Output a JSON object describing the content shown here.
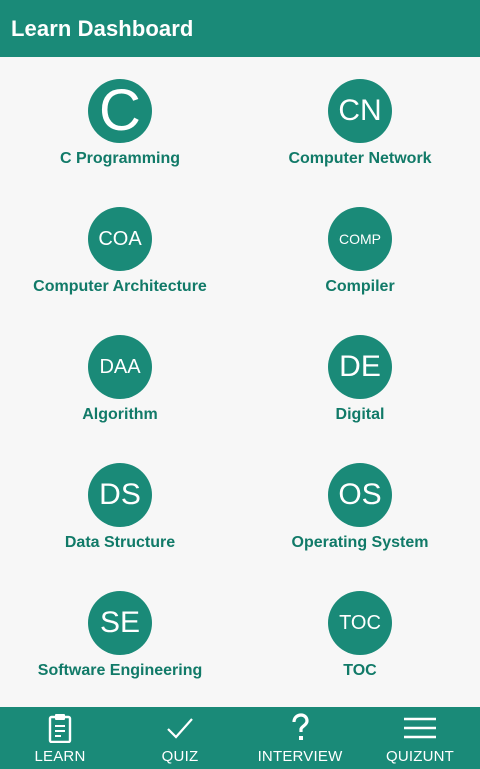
{
  "appbar": {
    "title": "Learn Dashboard"
  },
  "subjects": [
    {
      "abbr": "C",
      "label": "C Programming"
    },
    {
      "abbr": "CN",
      "label": "Computer Network"
    },
    {
      "abbr": "COA",
      "label": "Computer Architecture"
    },
    {
      "abbr": "COMP",
      "label": "Compiler"
    },
    {
      "abbr": "DAA",
      "label": "Algorithm"
    },
    {
      "abbr": "DE",
      "label": "Digital"
    },
    {
      "abbr": "DS",
      "label": "Data Structure"
    },
    {
      "abbr": "OS",
      "label": "Operating System"
    },
    {
      "abbr": "SE",
      "label": "Software Engineering"
    },
    {
      "abbr": "TOC",
      "label": "TOC"
    }
  ],
  "nav": [
    {
      "label": "LEARN",
      "icon": "clipboard-icon"
    },
    {
      "label": "QUIZ",
      "icon": "check-icon"
    },
    {
      "label": "INTERVIEW",
      "icon": "question-icon"
    },
    {
      "label": "QUIZUNT",
      "icon": "menu-icon"
    }
  ],
  "colors": {
    "primary": "#1a8a78",
    "label": "#117a68",
    "background": "#f7f7f7"
  }
}
